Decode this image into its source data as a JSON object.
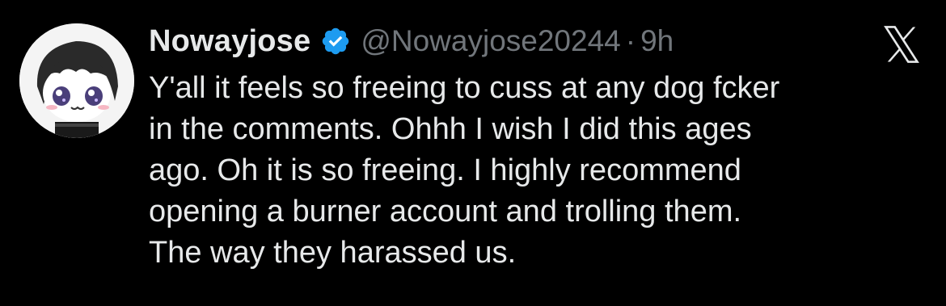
{
  "colors": {
    "background": "#000000",
    "primary_text": "#e7e9ea",
    "secondary_text": "#71767b",
    "verified_badge": "#1d9bf0"
  },
  "tweet": {
    "author": {
      "display_name": "Nowayjose",
      "handle": "@Nowayjose20244",
      "verified_icon": "verified-badge-icon",
      "avatar_icon": "anime-avatar"
    },
    "separator": "·",
    "timestamp": "9h",
    "platform_icon": "x-logo-icon",
    "lines": [
      "Y'all it feels so freeing to cuss at any dog fcker",
      "in the comments. Ohhh I wish I did this ages",
      "ago. Oh it is so freeing. I highly recommend",
      "opening a burner account and trolling them.",
      "The way they harassed us."
    ]
  }
}
